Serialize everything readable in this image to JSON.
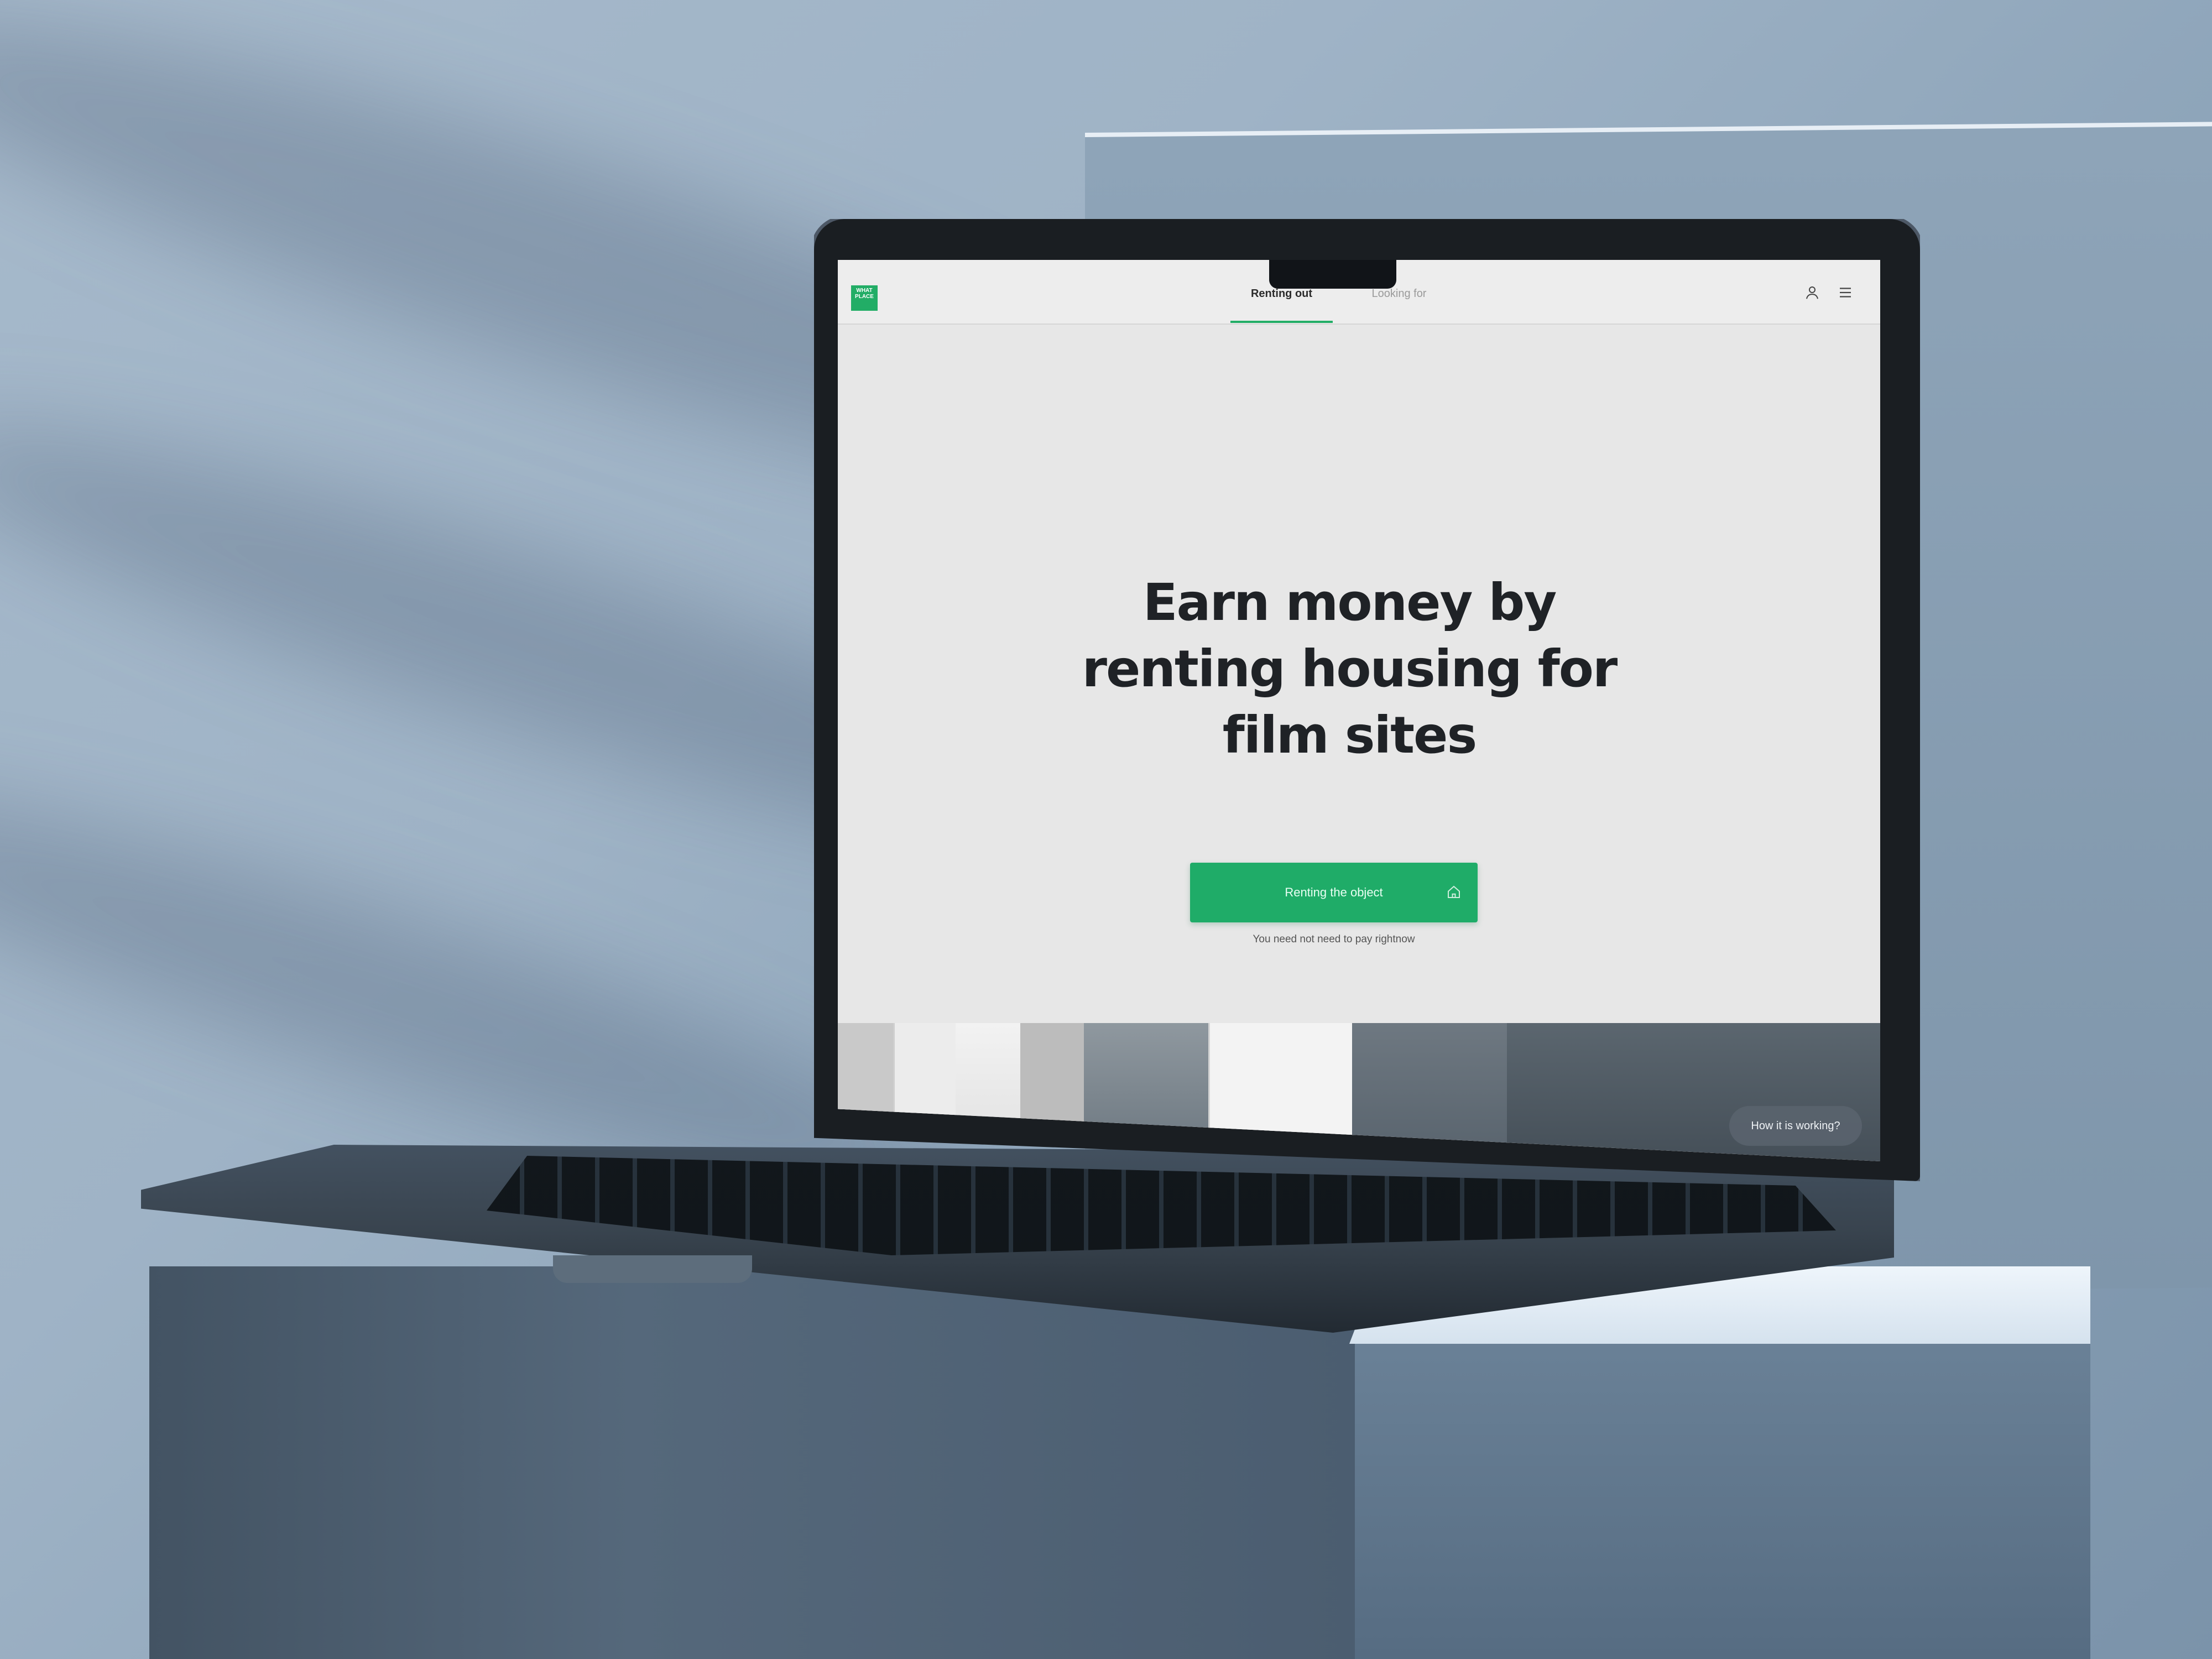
{
  "app": {
    "logo_line1": "WHAT",
    "logo_line2": "PLACE",
    "accent_color": "#22ad66"
  },
  "nav": {
    "tabs": [
      {
        "label": "Renting out",
        "active": true
      },
      {
        "label": "Looking for",
        "active": false
      }
    ],
    "icons": [
      "user-icon",
      "menu-icon"
    ]
  },
  "hero": {
    "headline_line1": "Earn money by",
    "headline_line2": "renting housing for",
    "headline_line3": "film sites"
  },
  "cta": {
    "label": "Renting the object",
    "icon": "home-icon",
    "note": "You need not need to pay rightnow"
  },
  "help": {
    "label": "How it is working?"
  }
}
